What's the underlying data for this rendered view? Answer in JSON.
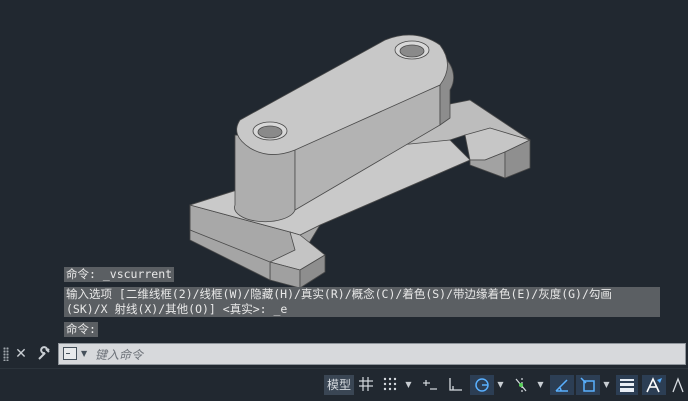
{
  "history": {
    "line1": "命令: _vscurrent",
    "line2": "输入选项 [二维线框(2)/线框(W)/隐藏(H)/真实(R)/概念(C)/着色(S)/带边缘着色(E)/灰度(G)/勾画",
    "line3": "(SK)/X 射线(X)/其他(O)] <真实>: _e",
    "line4": "命令:"
  },
  "command_line": {
    "placeholder": "键入命令",
    "value": ""
  },
  "statusbar": {
    "model_label": "模型"
  },
  "colors": {
    "viewport_bg": "#212830",
    "model_top": "#c7c7c7",
    "model_side": "#9c9c9c",
    "history_bg": "#5b5f63",
    "accent": "#59b0ff"
  },
  "icons": [
    "close-icon",
    "wrench-icon",
    "command-prompt-icon",
    "grid-icon",
    "snap-icon",
    "dynamic-input-icon",
    "ortho-icon",
    "polar-icon",
    "isodraft-icon",
    "object-snap-tracking-icon",
    "2d-object-snap-icon",
    "annotation-scale-icon",
    "lineweight-icon",
    "transparency-icon"
  ]
}
